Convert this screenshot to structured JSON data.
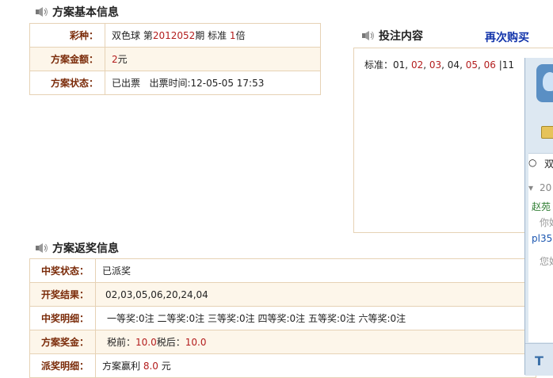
{
  "basic": {
    "title": "方案基本信息",
    "rows": [
      {
        "label": "彩种：",
        "value_html": [
          "双色球 第",
          "2012052",
          "期 标准 ",
          "1",
          "倍"
        ]
      },
      {
        "label": "方案金额：",
        "amount": "2",
        "unit": "元"
      },
      {
        "label": "方案状态：",
        "value": "已出票   出票时间:12-05-05 17:53"
      }
    ]
  },
  "bet": {
    "title": "投注内容",
    "rebuy": "再次购买",
    "prefix": "标准：",
    "numbers": [
      "01",
      "02",
      "03",
      "04",
      "05",
      "06"
    ],
    "number_colors": [
      "#222",
      "#b31d1d",
      "#b31d1d",
      "#222",
      "#b31d1d",
      "#b31d1d"
    ],
    "separator": "|",
    "blue": "11"
  },
  "payout": {
    "title": "方案返奖信息",
    "rows": [
      {
        "label": "中奖状态：",
        "value": "已派奖"
      },
      {
        "label": "开奖结果：",
        "value": "02,03,05,06,20,24,04"
      },
      {
        "label": "中奖明细：",
        "value": "一等奖:0注 二等奖:0注 三等奖:0注 四等奖:0注 五等奖:0注 六等奖:0注"
      },
      {
        "label": "方案奖金：",
        "before_label": "税前：",
        "before": "10.0",
        "after_label": "税后：",
        "after": "10.0"
      },
      {
        "label": "派奖明细：",
        "prefix": "方案赢利 ",
        "amount": "8.0",
        "unit": " 元"
      }
    ]
  },
  "chat": {
    "line1": "双",
    "line2": "20",
    "line3": "赵苑",
    "line4": "你好",
    "line5": "pl35",
    "line6": "您好",
    "bottom_icon": "T"
  }
}
